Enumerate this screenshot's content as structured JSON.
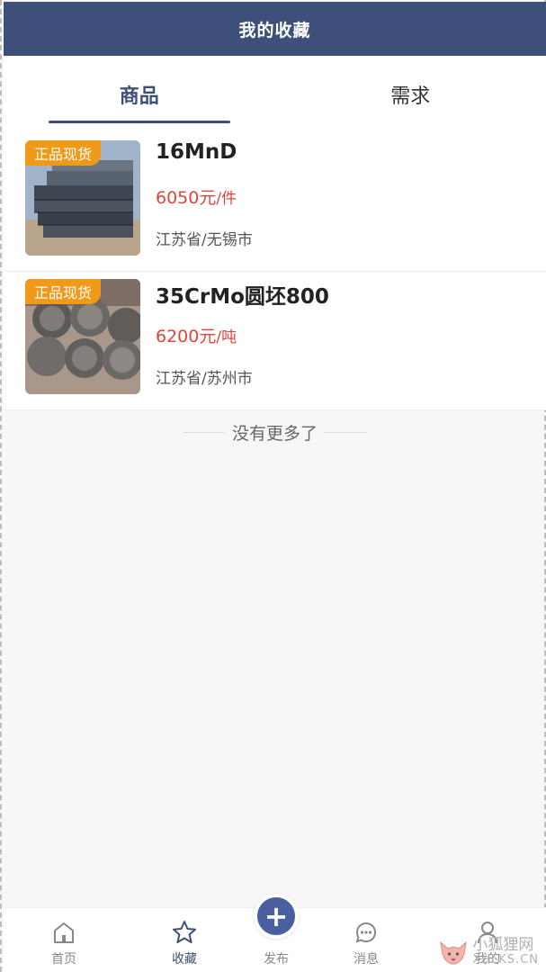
{
  "header": {
    "title": "我的收藏"
  },
  "tabs": [
    {
      "label": "商品",
      "active": true
    },
    {
      "label": "需求",
      "active": false
    }
  ],
  "items": [
    {
      "badge": "正品现货",
      "title": "16MnD",
      "price": "6050元",
      "unit": "/件",
      "location": "江苏省/无锡市"
    },
    {
      "badge": "正品现货",
      "title": "35CrMo圆坯800",
      "price": "6200元",
      "unit": "/吨",
      "location": "江苏省/苏州市"
    }
  ],
  "footer_note": "没有更多了",
  "tabbar": [
    {
      "label": "首页",
      "icon": "home-icon"
    },
    {
      "label": "收藏",
      "icon": "star-icon",
      "active": true
    },
    {
      "label": "发布",
      "icon": "plus-icon"
    },
    {
      "label": "消息",
      "icon": "message-icon"
    },
    {
      "label": "我的",
      "icon": "user-icon"
    }
  ],
  "watermark": {
    "line1": "小狐狸网",
    "line2": "XHLKS.CN"
  },
  "colors": {
    "brand": "#3e5079",
    "price": "#e0443a",
    "badge": "#f09a1a"
  }
}
